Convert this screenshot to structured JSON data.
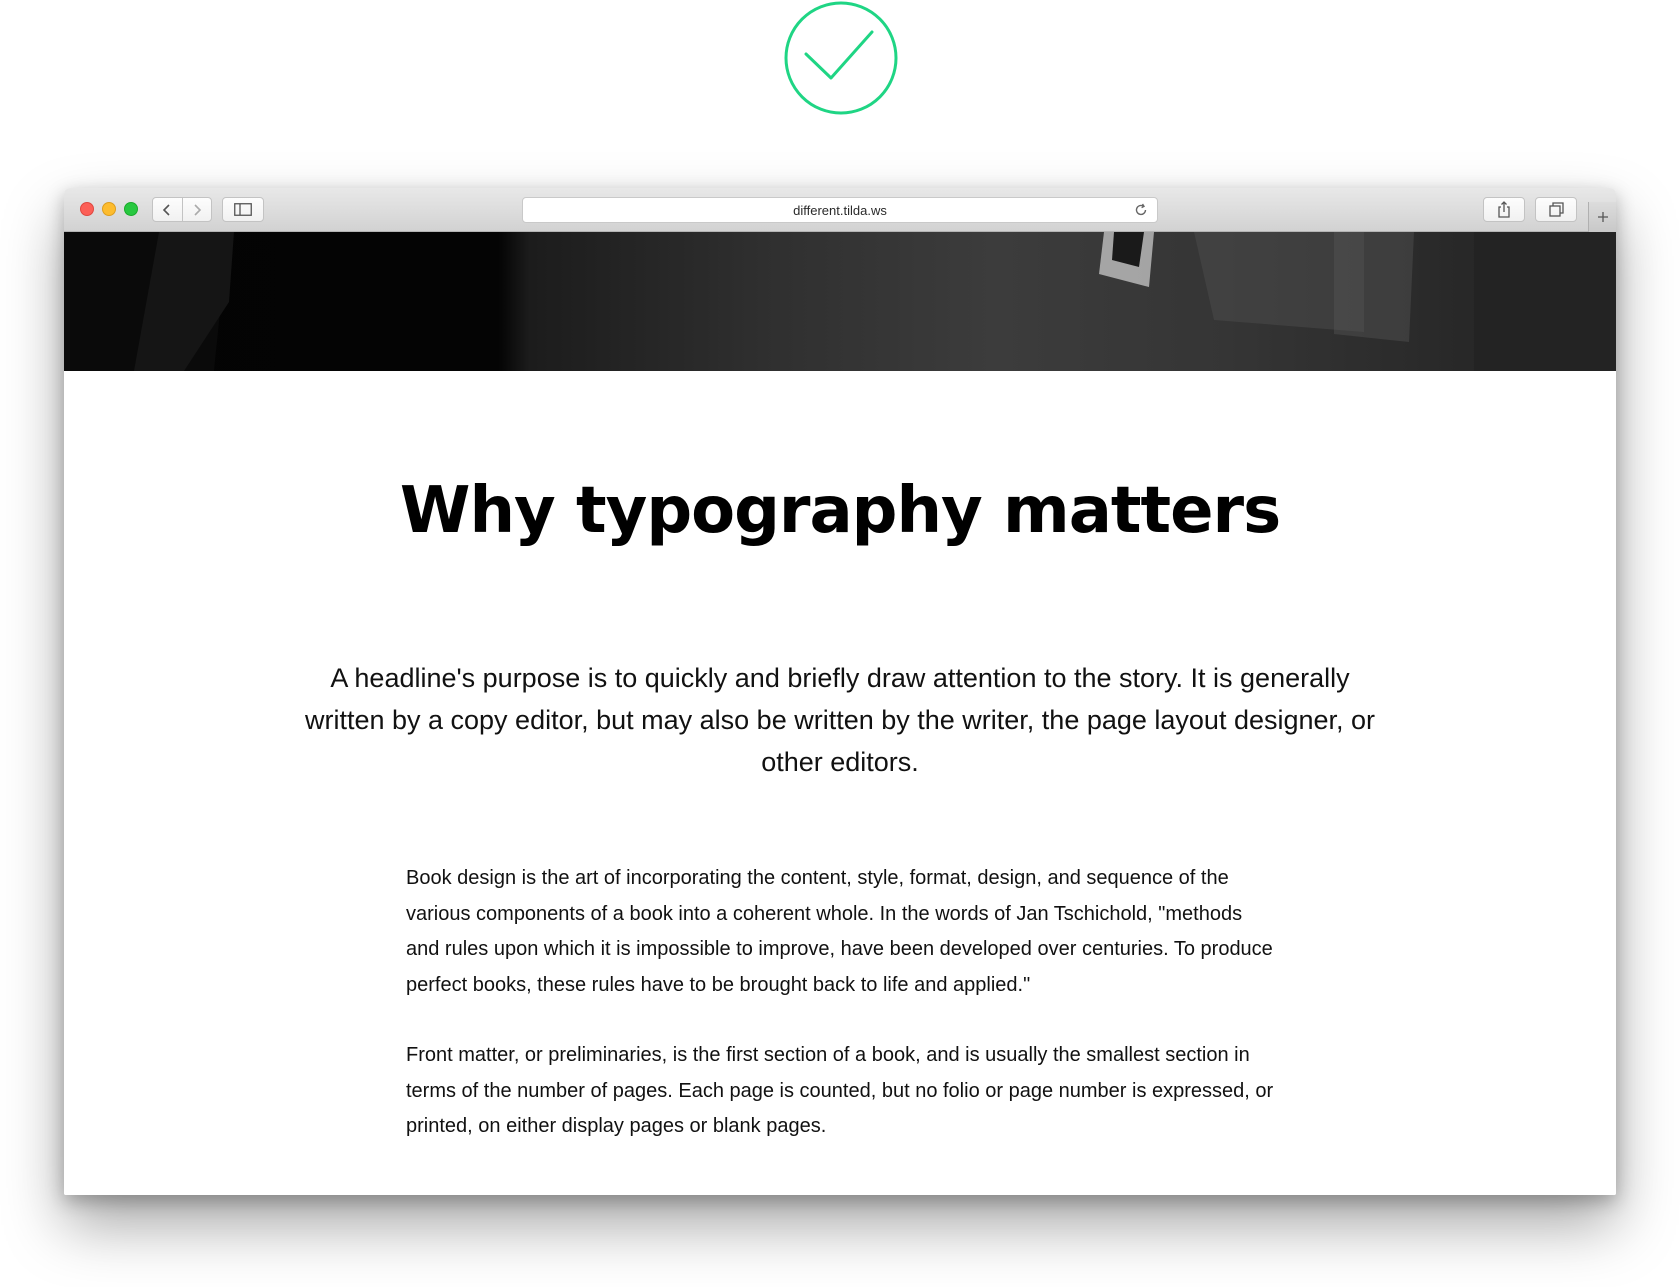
{
  "browser": {
    "url": "different.tilda.ws",
    "traffic_lights": [
      "close",
      "minimize",
      "zoom"
    ]
  },
  "colors": {
    "check_accent": "#1fd584",
    "close": "#fc5f57",
    "minimize": "#fdbc2e",
    "zoom": "#28c840"
  },
  "article": {
    "headline": "Why typography matters",
    "lead": "A headline's purpose is to quickly and briefly draw attention to the story. It is generally written by a copy editor, but may also be written by the writer, the page layout designer, or other editors.",
    "paragraphs": [
      "Book design is the art of incorporating the content, style, format, design, and sequence of the various components of a book into a coherent whole. In the words of Jan Tschichold, \"methods and rules upon which it is impossible to improve, have been developed over centuries. To produce perfect books, these rules have to be brought back to life and applied.\"",
      "Front matter, or preliminaries, is the first section of a book, and is usually the smallest section in terms of the number of pages. Each page is counted, but no folio or page number is expressed, or printed, on either display pages or blank pages."
    ]
  }
}
